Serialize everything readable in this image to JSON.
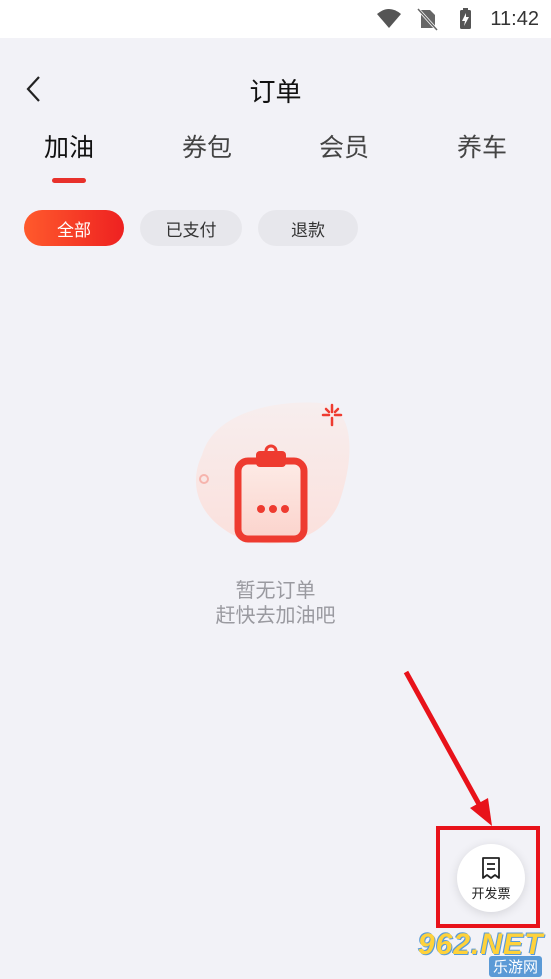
{
  "status_bar": {
    "time": "11:42"
  },
  "header": {
    "title": "订单"
  },
  "tabs": [
    {
      "label": "加油",
      "active": true
    },
    {
      "label": "券包",
      "active": false
    },
    {
      "label": "会员",
      "active": false
    },
    {
      "label": "养车",
      "active": false
    }
  ],
  "filters": [
    {
      "label": "全部",
      "active": true
    },
    {
      "label": "已支付",
      "active": false
    },
    {
      "label": "退款",
      "active": false
    }
  ],
  "empty_state": {
    "line1": "暂无订单",
    "line2": "赶快去加油吧"
  },
  "invoice_button": {
    "label": "开发票"
  },
  "watermark": {
    "brand": "962.NET",
    "sub": "乐游网"
  },
  "colors": {
    "accent": "#e8312b",
    "annotation": "#e8121a",
    "background": "#f2f2f7"
  }
}
